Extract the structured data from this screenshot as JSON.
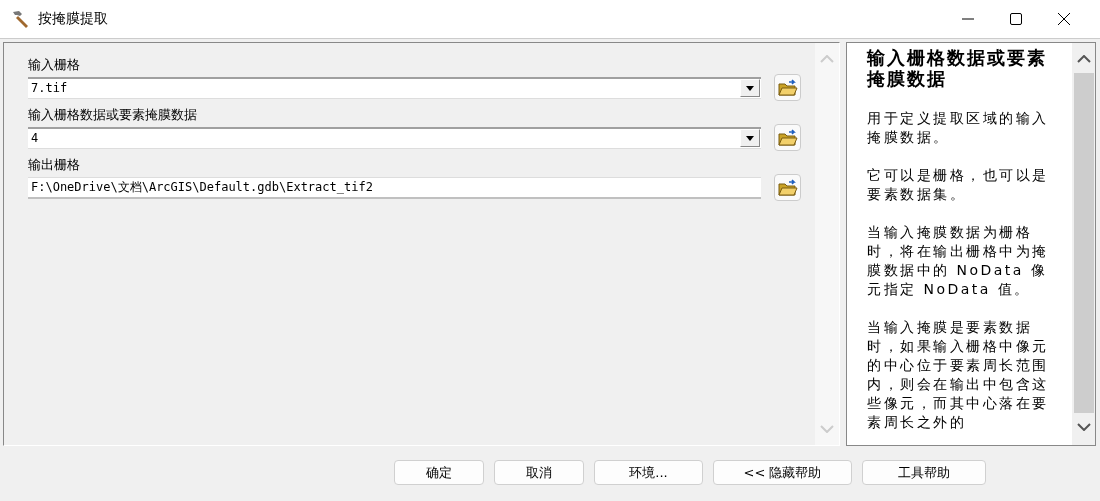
{
  "window": {
    "title": "按掩膜提取"
  },
  "parameters": [
    {
      "label": "输入栅格",
      "kind": "combo",
      "value": "7.tif"
    },
    {
      "label": "输入栅格数据或要素掩膜数据",
      "kind": "combo",
      "value": "4"
    },
    {
      "label": "输出栅格",
      "kind": "text",
      "value": "F:\\OneDrive\\文档\\ArcGIS\\Default.gdb\\Extract_tif2"
    }
  ],
  "help": {
    "title": "输入栅格数据或要素掩膜数据",
    "paragraphs": [
      "用于定义提取区域的输入掩膜数据。",
      "它可以是栅格，也可以是要素数据集。",
      "当输入掩膜数据为栅格时，将在输出栅格中为掩膜数据中的 NoData 像元指定 NoData 值。",
      "当输入掩膜是要素数据时，如果输入栅格中像元的中心位于要素周长范围内，则会在输出中包含这些像元，而其中心落在要素周长之外的"
    ]
  },
  "buttons": [
    "确定",
    "取消",
    "环境...",
    "<< 隐藏帮助",
    "工具帮助"
  ]
}
